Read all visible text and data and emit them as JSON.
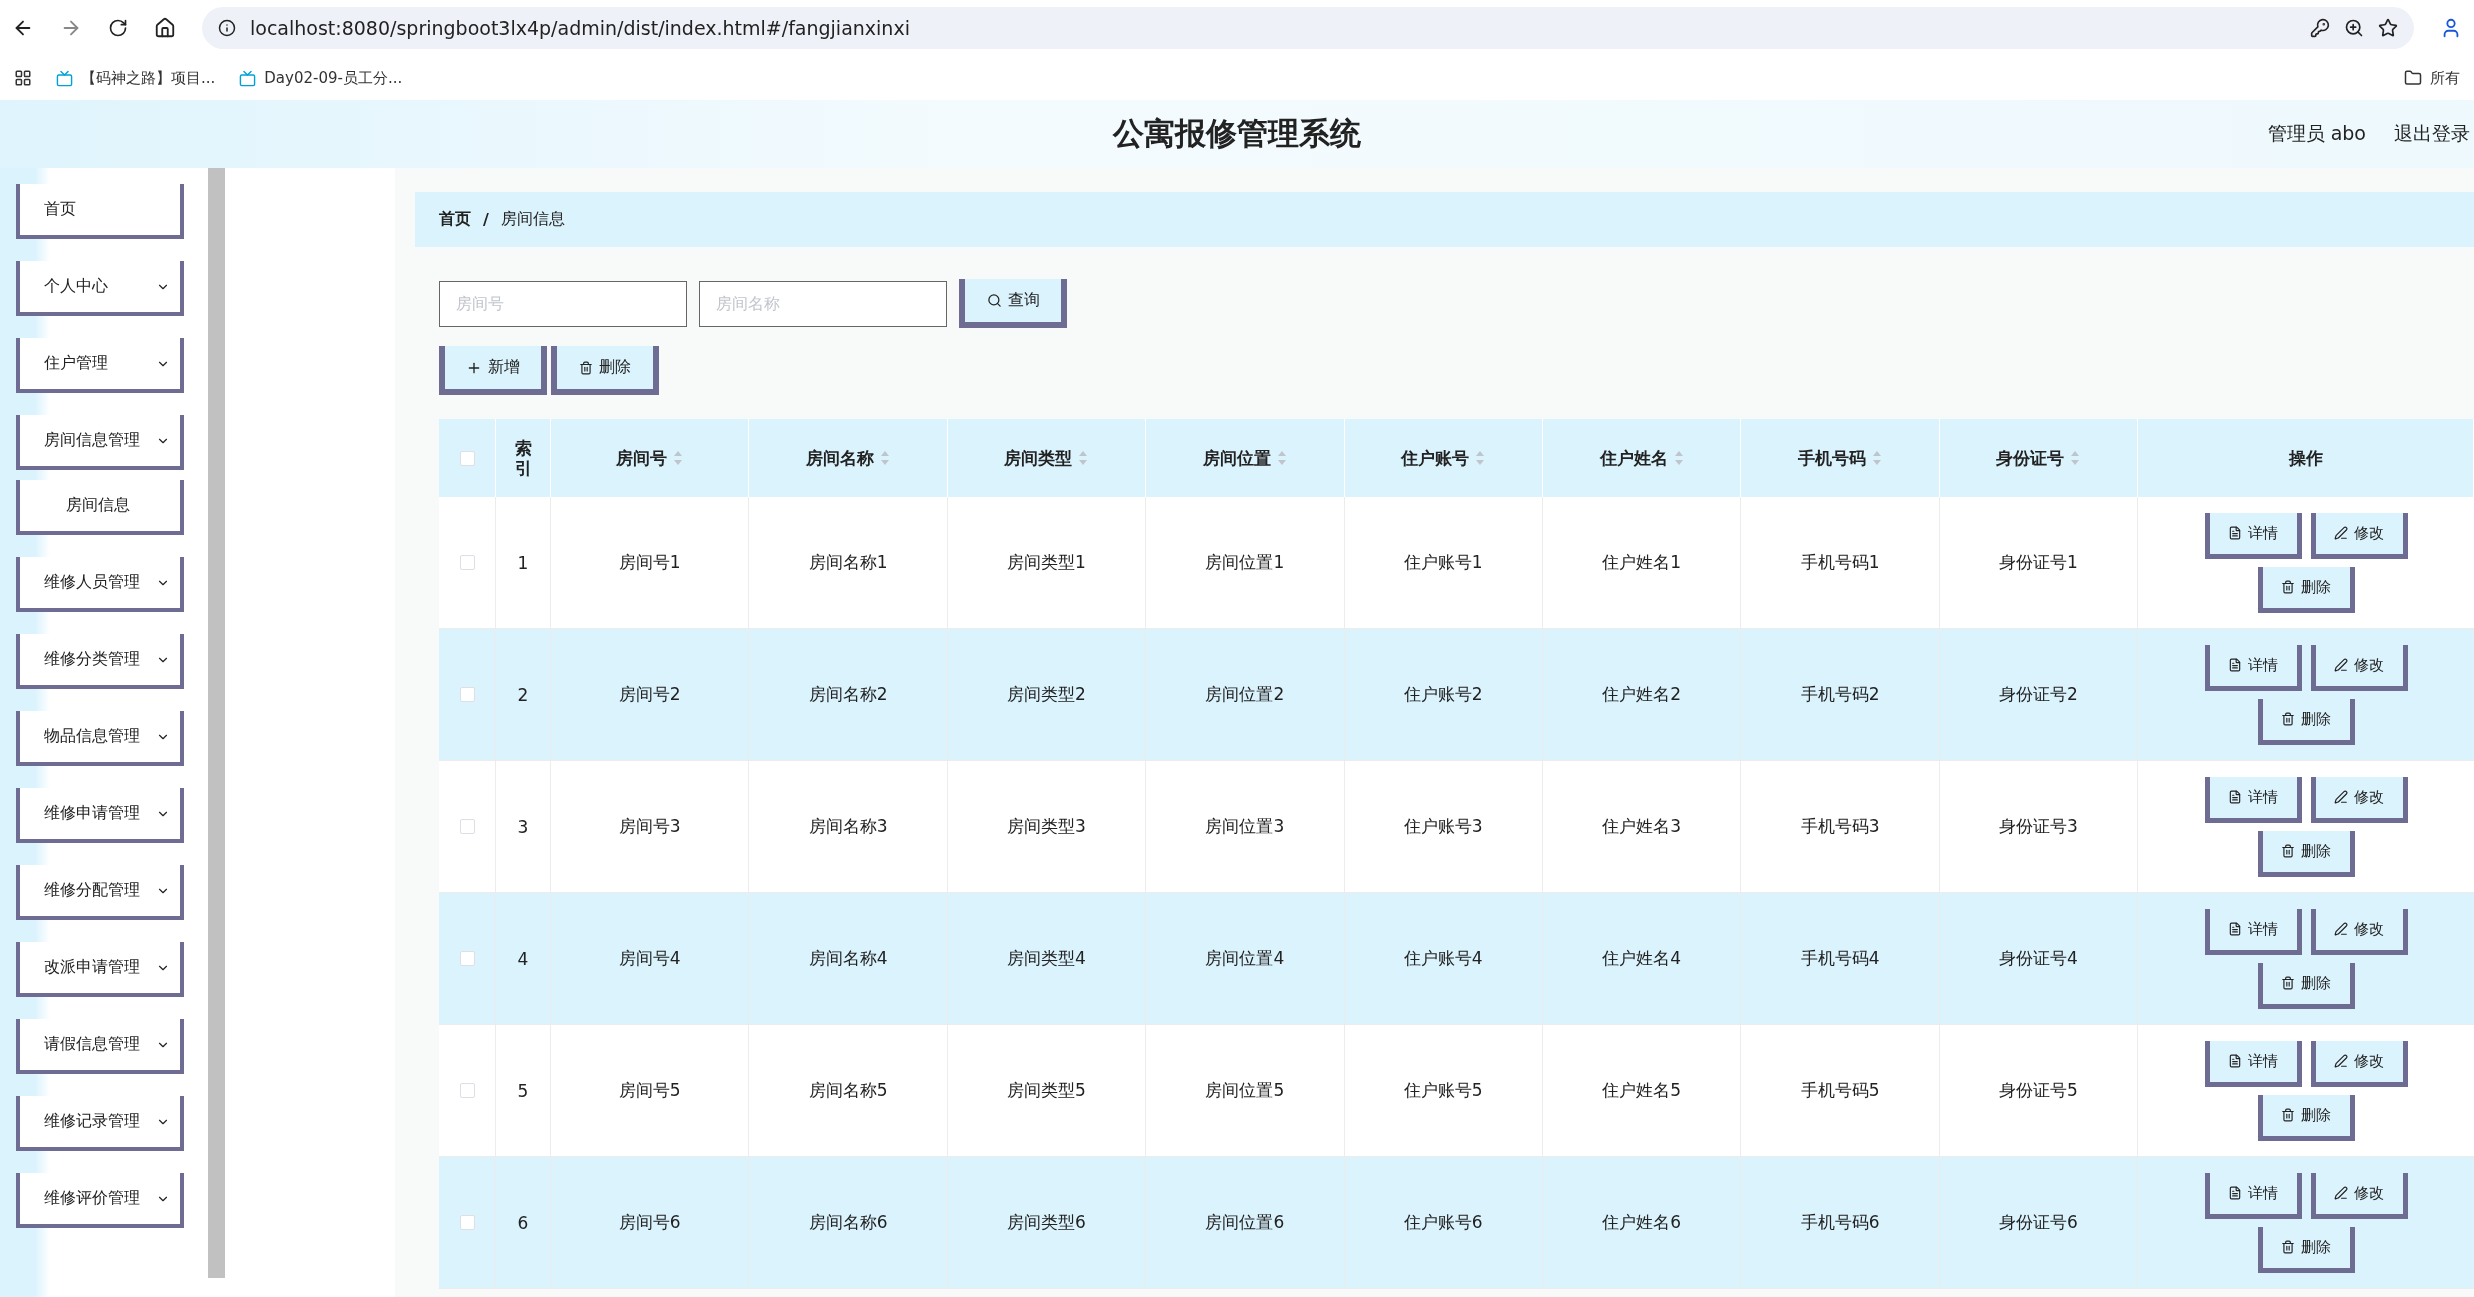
{
  "browser": {
    "url": "localhost:8080/springboot3lx4p/admin/dist/index.html#/fangjianxinxi",
    "bookmarks": [
      "【码神之路】项目...",
      "Day02-09-员工分..."
    ],
    "folder": "所有"
  },
  "header": {
    "title": "公寓报修管理系统",
    "user": "管理员 abo",
    "logout": "退出登录"
  },
  "sidebar": {
    "items": [
      {
        "label": "首页",
        "kind": "link"
      },
      {
        "label": "个人中心",
        "kind": "menu"
      },
      {
        "label": "住户管理",
        "kind": "menu"
      },
      {
        "label": "房间信息管理",
        "kind": "menu",
        "children": [
          {
            "label": "房间信息"
          }
        ]
      },
      {
        "label": "维修人员管理",
        "kind": "menu"
      },
      {
        "label": "维修分类管理",
        "kind": "menu"
      },
      {
        "label": "物品信息管理",
        "kind": "menu"
      },
      {
        "label": "维修申请管理",
        "kind": "menu"
      },
      {
        "label": "维修分配管理",
        "kind": "menu"
      },
      {
        "label": "改派申请管理",
        "kind": "menu"
      },
      {
        "label": "请假信息管理",
        "kind": "menu"
      },
      {
        "label": "维修记录管理",
        "kind": "menu"
      },
      {
        "label": "维修评价管理",
        "kind": "menu"
      }
    ]
  },
  "breadcrumb": {
    "items": [
      "首页",
      "房间信息"
    ],
    "separator": "/"
  },
  "search": {
    "fields": [
      {
        "placeholder": "房间号"
      },
      {
        "placeholder": "房间名称"
      }
    ],
    "button": "查询"
  },
  "actions": [
    {
      "label": "新增",
      "kind": "add"
    },
    {
      "label": "删除",
      "kind": "delete"
    }
  ],
  "table": {
    "select_all_checked": false,
    "index_column": "索引",
    "columns": [
      "房间号",
      "房间名称",
      "房间类型",
      "房间位置",
      "住户账号",
      "住户姓名",
      "手机号码",
      "身份证号"
    ],
    "action_column": "操作",
    "rows": [
      {
        "index": "1",
        "checked": false,
        "cells": [
          "房间号1",
          "房间名称1",
          "房间类型1",
          "房间位置1",
          "住户账号1",
          "住户姓名1",
          "手机号码1",
          "身份证号1"
        ],
        "buttons": [
          {
            "label": "详情",
            "kind": "detail"
          },
          {
            "label": "修改",
            "kind": "edit"
          },
          {
            "label": "删除",
            "kind": "delete"
          }
        ]
      },
      {
        "index": "2",
        "checked": false,
        "cells": [
          "房间号2",
          "房间名称2",
          "房间类型2",
          "房间位置2",
          "住户账号2",
          "住户姓名2",
          "手机号码2",
          "身份证号2"
        ],
        "buttons": [
          {
            "label": "详情",
            "kind": "detail"
          },
          {
            "label": "修改",
            "kind": "edit"
          },
          {
            "label": "删除",
            "kind": "delete"
          }
        ]
      },
      {
        "index": "3",
        "checked": false,
        "cells": [
          "房间号3",
          "房间名称3",
          "房间类型3",
          "房间位置3",
          "住户账号3",
          "住户姓名3",
          "手机号码3",
          "身份证号3"
        ],
        "buttons": [
          {
            "label": "详情",
            "kind": "detail"
          },
          {
            "label": "修改",
            "kind": "edit"
          },
          {
            "label": "删除",
            "kind": "delete"
          }
        ]
      },
      {
        "index": "4",
        "checked": false,
        "cells": [
          "房间号4",
          "房间名称4",
          "房间类型4",
          "房间位置4",
          "住户账号4",
          "住户姓名4",
          "手机号码4",
          "身份证号4"
        ],
        "buttons": [
          {
            "label": "详情",
            "kind": "detail"
          },
          {
            "label": "修改",
            "kind": "edit"
          },
          {
            "label": "删除",
            "kind": "delete"
          }
        ]
      },
      {
        "index": "5",
        "checked": false,
        "cells": [
          "房间号5",
          "房间名称5",
          "房间类型5",
          "房间位置5",
          "住户账号5",
          "住户姓名5",
          "手机号码5",
          "身份证号5"
        ],
        "buttons": [
          {
            "label": "详情",
            "kind": "detail"
          },
          {
            "label": "修改",
            "kind": "edit"
          },
          {
            "label": "删除",
            "kind": "delete"
          }
        ]
      },
      {
        "index": "6",
        "checked": false,
        "cells": [
          "房间号6",
          "房间名称6",
          "房间类型6",
          "房间位置6",
          "住户账号6",
          "住户姓名6",
          "手机号码6",
          "身份证号6"
        ],
        "buttons": [
          {
            "label": "详情",
            "kind": "detail"
          },
          {
            "label": "修改",
            "kind": "edit"
          },
          {
            "label": "删除",
            "kind": "delete"
          }
        ]
      }
    ]
  }
}
